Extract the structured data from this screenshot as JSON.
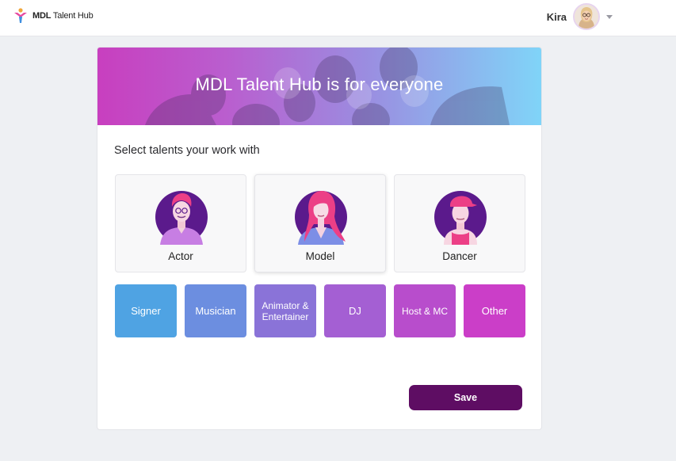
{
  "header": {
    "logo_bold": "MDL",
    "logo_rest": " Talent Hub",
    "user_name": "Kira"
  },
  "banner": {
    "title": "MDL Talent Hub is for everyone"
  },
  "prompt": "Select talents your work with",
  "main_talents": [
    {
      "label": "Actor",
      "icon": "actor-illustration"
    },
    {
      "label": "Model",
      "icon": "model-illustration"
    },
    {
      "label": "Dancer",
      "icon": "dancer-illustration"
    }
  ],
  "other_talents": [
    {
      "label": "Signer",
      "color": "#4fa3e3"
    },
    {
      "label": "Musician",
      "color": "#6c8ee0"
    },
    {
      "label": "Animator & Entertainer",
      "color": "#8a73d8"
    },
    {
      "label": "DJ",
      "color": "#a45fd3"
    },
    {
      "label": "Host & MC",
      "color": "#b84dcc"
    },
    {
      "label": "Other",
      "color": "#cb3ec8"
    }
  ],
  "save_label": "Save",
  "colors": {
    "accent": "#5e0d63",
    "tile_purple": "#5b1a8c",
    "banner_start": "#c83fbf",
    "banner_end": "#80d4f8"
  }
}
